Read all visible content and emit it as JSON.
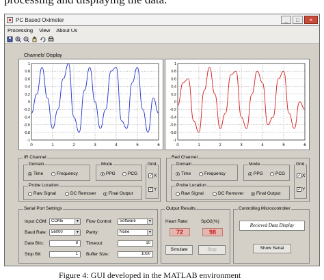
{
  "page": {
    "caption_top_fragment": "processing and displaying the data.",
    "caption_bottom_fragment": "Figure 4: GUI developed in the MATLAB environment"
  },
  "window": {
    "title": "PC Based Oximeter",
    "controls": {
      "minimize": "_",
      "maximize": "□",
      "close": "×"
    },
    "menu": [
      "Processing",
      "View",
      "About Us"
    ],
    "toolbar_icons": [
      "new-icon",
      "zoom-in-icon",
      "zoom-out-icon",
      "pan-icon",
      "rotate-icon",
      "print-icon"
    ]
  },
  "channels_display": {
    "label": "Channels' Display"
  },
  "chart_data": [
    {
      "type": "line",
      "title": "",
      "x": [
        0,
        0.25,
        0.5,
        0.75,
        1,
        1.25,
        1.5,
        1.75,
        2,
        2.25,
        2.5,
        2.75,
        3,
        3.25,
        3.5,
        3.75,
        4,
        4.25,
        4.5,
        4.75,
        5,
        5.25,
        5.5,
        5.75,
        6
      ],
      "series": [
        {
          "values": [
            -0.3,
            0.2,
            0.9,
            0.1,
            -0.7,
            -0.2,
            0.6,
            1.0,
            -0.4,
            -0.8,
            0.3,
            0.9,
            0.0,
            -0.7,
            -0.2,
            0.8,
            0.9,
            -0.5,
            -0.7,
            0.5,
            0.9,
            -0.2,
            -0.8,
            0.1,
            -0.3
          ]
        }
      ],
      "xlim": [
        0,
        6
      ],
      "ylim": [
        -1,
        1
      ],
      "xticks": [
        "0",
        "1",
        "2",
        "3",
        "4",
        "5",
        "6"
      ],
      "yticks": [
        "1",
        "0.8",
        "0.6",
        "0.4",
        "0.2",
        "0",
        "-0.2",
        "-0.4",
        "-0.6",
        "-0.8",
        "-1"
      ],
      "grid": true,
      "color": "#2233cc"
    },
    {
      "type": "line",
      "title": "",
      "x": [
        0,
        0.25,
        0.5,
        0.75,
        1,
        1.25,
        1.5,
        1.75,
        2,
        2.25,
        2.5,
        2.75,
        3,
        3.25,
        3.5,
        3.75,
        4,
        4.25,
        4.5,
        4.75,
        5,
        5.25,
        5.5,
        5.75,
        6
      ],
      "series": [
        {
          "values": [
            -0.1,
            0.5,
            0.6,
            -0.5,
            -0.8,
            0.3,
            0.9,
            0.2,
            -0.7,
            -0.3,
            0.7,
            0.8,
            -0.4,
            -0.7,
            0.2,
            0.8,
            0.5,
            -0.6,
            -0.4,
            0.6,
            0.8,
            -0.3,
            -0.7,
            0.0,
            -0.2
          ]
        }
      ],
      "xlim": [
        0,
        6
      ],
      "ylim": [
        -1,
        1
      ],
      "xticks": [
        "0",
        "1",
        "2",
        "3",
        "4",
        "5",
        "6"
      ],
      "yticks": [
        "1",
        "0.8",
        "0.6",
        "0.4",
        "0.2",
        "0",
        "-0.2",
        "-0.4",
        "-0.6",
        "-0.8",
        "-1"
      ],
      "grid": true,
      "color": "#d42020"
    }
  ],
  "ir_channel": {
    "title": "IR Channel",
    "domain": {
      "title": "Domain",
      "options": [
        "Time",
        "Frequency"
      ],
      "selected": "Time"
    },
    "mode": {
      "title": "Mode",
      "options": [
        "PPG",
        "PCG"
      ],
      "selected": "PPG"
    },
    "grid": {
      "title": "Grid",
      "x_label": "X",
      "y_label": "Y",
      "x_checked": true,
      "y_checked": true
    },
    "probe": {
      "title": "Probe Location",
      "options": [
        "Raw Signal",
        "DC Remover",
        "Final Output"
      ],
      "selected": "Final Output"
    }
  },
  "red_channel": {
    "title": "Red Channel",
    "domain": {
      "title": "Domain",
      "options": [
        "Time",
        "Frequency"
      ],
      "selected": "Time"
    },
    "mode": {
      "title": "Mode",
      "options": [
        "PPG",
        "PCG"
      ],
      "selected": "PPG"
    },
    "grid": {
      "title": "Grid",
      "x_label": "X",
      "y_label": "Y",
      "x_checked": true,
      "y_checked": true
    },
    "probe": {
      "title": "Probe Location",
      "options": [
        "Raw Signal",
        "DC Remover",
        "Final Output"
      ],
      "selected": "Final Output"
    }
  },
  "serial": {
    "title": "Serial Port Settings",
    "input_com_label": "Input COM:",
    "input_com_value": "COM5",
    "baud_rate_label": "Baud Rate:",
    "baud_rate_value": "56000",
    "data_bits_label": "Data Bits:",
    "data_bits_value": "8",
    "stop_bit_label": "Stop Bit:",
    "stop_bit_value": "1",
    "flow_control_label": "Flow Control:",
    "flow_control_value": "Software",
    "parity_label": "Parity:",
    "parity_value": "None",
    "timeout_label": "Timeout:",
    "timeout_value": "10",
    "buffer_size_label": "Buffer Size:",
    "buffer_size_value": "1000"
  },
  "output": {
    "title": "Output Results",
    "heart_rate_label": "Heart Rate:",
    "spo2_label": "SpO2(%)",
    "heart_rate_value": "72",
    "spo2_value": "98",
    "simulate_label": "Simulate",
    "stop_label": "Stop"
  },
  "microcontroller": {
    "title": "Controlling Microcontroller",
    "banner": "Recieved Data Display",
    "show_serial_label": "Show Serial"
  }
}
